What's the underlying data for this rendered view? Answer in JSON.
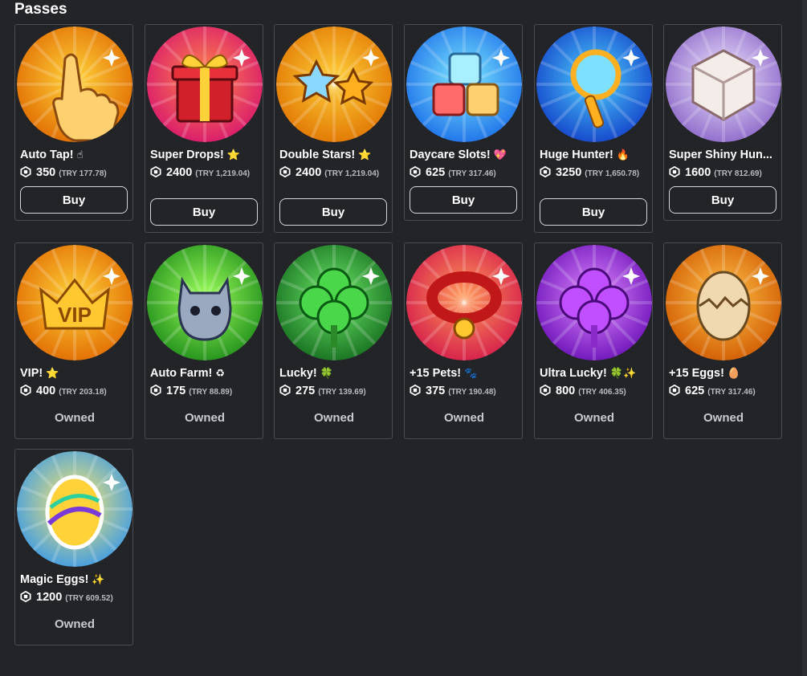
{
  "section": {
    "title": "Passes"
  },
  "buy_label": "Buy",
  "owned_label": "Owned",
  "passes": [
    {
      "name": "Auto Tap!",
      "emoji": "☝",
      "price": "350",
      "try": "(TRY 177.78)",
      "state": "buy",
      "icon": "tap-hand-icon",
      "bg": [
        "#ffd23a",
        "#e06a00"
      ]
    },
    {
      "name": "Super Drops!",
      "emoji": "⭐",
      "price": "2400",
      "try": "(TRY 1,219.04)",
      "state": "buy",
      "icon": "gift-box-icon",
      "bg": [
        "#ff8a4a",
        "#d8156e"
      ]
    },
    {
      "name": "Double Stars!",
      "emoji": "⭐",
      "price": "2400",
      "try": "(TRY 1,219.04)",
      "state": "buy",
      "icon": "double-stars-icon",
      "bg": [
        "#ffcf3a",
        "#e07400"
      ]
    },
    {
      "name": "Daycare Slots!",
      "emoji": "💖",
      "price": "625",
      "try": "(TRY 317.46)",
      "state": "buy",
      "icon": "daycare-cubes-icon",
      "bg": [
        "#7ee8ff",
        "#1a6ee8"
      ]
    },
    {
      "name": "Huge Hunter!",
      "emoji": "🔥",
      "price": "3250",
      "try": "(TRY 1,650.78)",
      "state": "buy",
      "icon": "magnifier-icon",
      "bg": [
        "#4fd0ff",
        "#1240c8"
      ]
    },
    {
      "name": "Super Shiny Hun...",
      "emoji": "",
      "price": "1600",
      "try": "(TRY 812.69)",
      "state": "buy",
      "icon": "shiny-cube-icon",
      "bg": [
        "#f2e8ff",
        "#8a66c8"
      ]
    },
    {
      "name": "VIP!",
      "emoji": "⭐",
      "price": "400",
      "try": "(TRY 203.18)",
      "state": "owned",
      "icon": "vip-crown-icon",
      "bg": [
        "#ffd23a",
        "#e06a00"
      ]
    },
    {
      "name": "Auto Farm!",
      "emoji": "♻",
      "price": "175",
      "try": "(TRY 88.89)",
      "state": "owned",
      "icon": "cat-pet-icon",
      "bg": [
        "#9cff5a",
        "#1e8c1a"
      ]
    },
    {
      "name": "Lucky!",
      "emoji": "🍀",
      "price": "275",
      "try": "(TRY 139.69)",
      "state": "owned",
      "icon": "clover-icon",
      "bg": [
        "#6fea6a",
        "#146c1e"
      ]
    },
    {
      "name": "+15 Pets!",
      "emoji": "🐾",
      "price": "375",
      "try": "(TRY 190.48)",
      "state": "owned",
      "icon": "pet-collar-icon",
      "bg": [
        "#ff9a5a",
        "#d41a4a"
      ]
    },
    {
      "name": "Ultra Lucky!",
      "emoji": "🍀✨",
      "price": "800",
      "try": "(TRY 406.35)",
      "state": "owned",
      "icon": "purple-clover-icon",
      "bg": [
        "#e08aff",
        "#6a10b8"
      ]
    },
    {
      "name": "+15 Eggs!",
      "emoji": "🥚",
      "price": "625",
      "try": "(TRY 317.46)",
      "state": "owned",
      "icon": "cracked-egg-icon",
      "bg": [
        "#ffc24a",
        "#d05a00"
      ]
    },
    {
      "name": "Magic Eggs!",
      "emoji": "✨",
      "price": "1200",
      "try": "(TRY 609.52)",
      "state": "owned",
      "icon": "rainbow-egg-icon",
      "bg": [
        "#ffe96a",
        "#3a9ae8"
      ]
    }
  ]
}
